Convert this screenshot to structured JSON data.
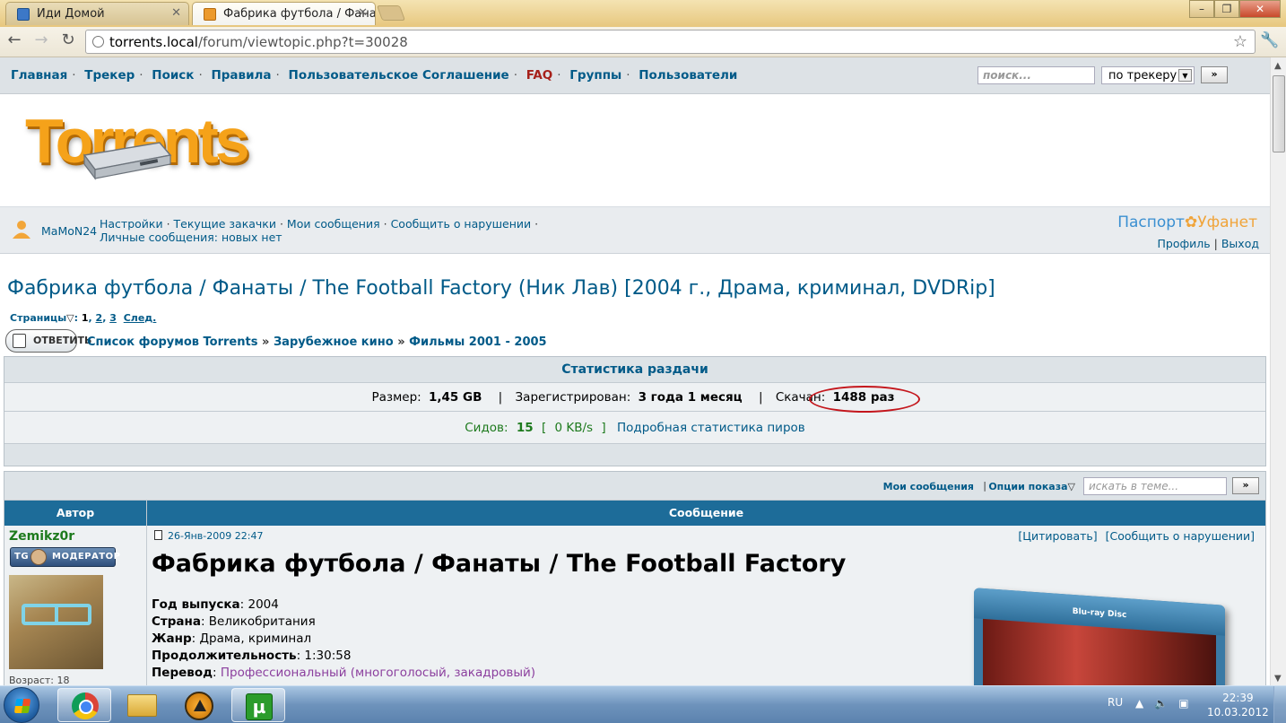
{
  "browser": {
    "tabs": [
      {
        "title": "Иди Домой"
      },
      {
        "title": "Фабрика футбола / Фанаты"
      }
    ],
    "url_host": "torrents.local",
    "url_path": "/forum/viewtopic.php?t=30028"
  },
  "topnav": {
    "items": [
      "Главная",
      "Трекер",
      "Поиск",
      "Правила",
      "Пользовательское Соглашение",
      "FAQ",
      "Группы",
      "Пользователи"
    ],
    "search_placeholder": "поиск...",
    "search_scope": "по трекеру",
    "go_label": "»"
  },
  "logo": {
    "text": "Torrents"
  },
  "userbar": {
    "username": "MaMoN24",
    "links_line1": [
      "Настройки",
      "Текущие закачки",
      "Мои сообщения",
      "Сообщить о нарушении"
    ],
    "pm_label": "Личные сообщения:",
    "pm_value": "новых нет",
    "passport_a": "Паспорт",
    "passport_b": "Уфанет",
    "profile": "Профиль",
    "logout": "Выход"
  },
  "topic": {
    "title": "Фабрика футбола / Фанаты / The Football Factory (Ник Лав) [2004 г., Драма, криминал, DVDRip]",
    "pages_label": "Страницы",
    "pages": [
      "1",
      "2",
      "3"
    ],
    "next": "След.",
    "reply_label": "ОТВЕТИТЬ",
    "breadcrumbs": [
      "Список форумов Torrents",
      "Зарубежное кино",
      "Фильмы 2001 - 2005"
    ]
  },
  "stats": {
    "header": "Статистика раздачи",
    "size_label": "Размер:",
    "size_value": "1,45 GB",
    "registered_label": "Зарегистрирован:",
    "registered_value": "3 года 1 месяц",
    "downloaded_label": "Скачан:",
    "downloaded_value": "1488 раз",
    "seeds_label": "Сидов:",
    "seeds_value": "15",
    "speed": "0 KB/s",
    "peers_link": "Подробная статистика пиров"
  },
  "posts": {
    "my_posts": "Мои сообщения",
    "view_options": "Опции показа",
    "topic_search_placeholder": "искать в теме...",
    "go_label": "»",
    "col_author": "Автор",
    "col_message": "Сообщение",
    "author_name": "Zemikz0r",
    "rank_prefix": "TG",
    "rank_label": "МОДЕРАТОР",
    "age_label": "Возраст: 18",
    "date": "26-Янв-2009 22:47",
    "quote": "[Цитировать]",
    "report": "[Сообщить о нарушении]",
    "post_title": "Фабрика футбола / Фанаты / The Football Factory",
    "fields": [
      {
        "label": "Год выпуска",
        "value": "2004"
      },
      {
        "label": "Страна",
        "value": "Великобритания"
      },
      {
        "label": "Жанр",
        "value": "Драма, криминал"
      },
      {
        "label": "Продолжительность",
        "value": "1:30:58"
      },
      {
        "label": "Перевод",
        "value": "Профессиональный (многоголосый, закадровый)"
      }
    ],
    "bluray_label": "Blu-ray Disc"
  },
  "taskbar": {
    "lang": "RU",
    "time": "22:39",
    "date": "10.03.2012",
    "utorrent_glyph": "µ"
  }
}
